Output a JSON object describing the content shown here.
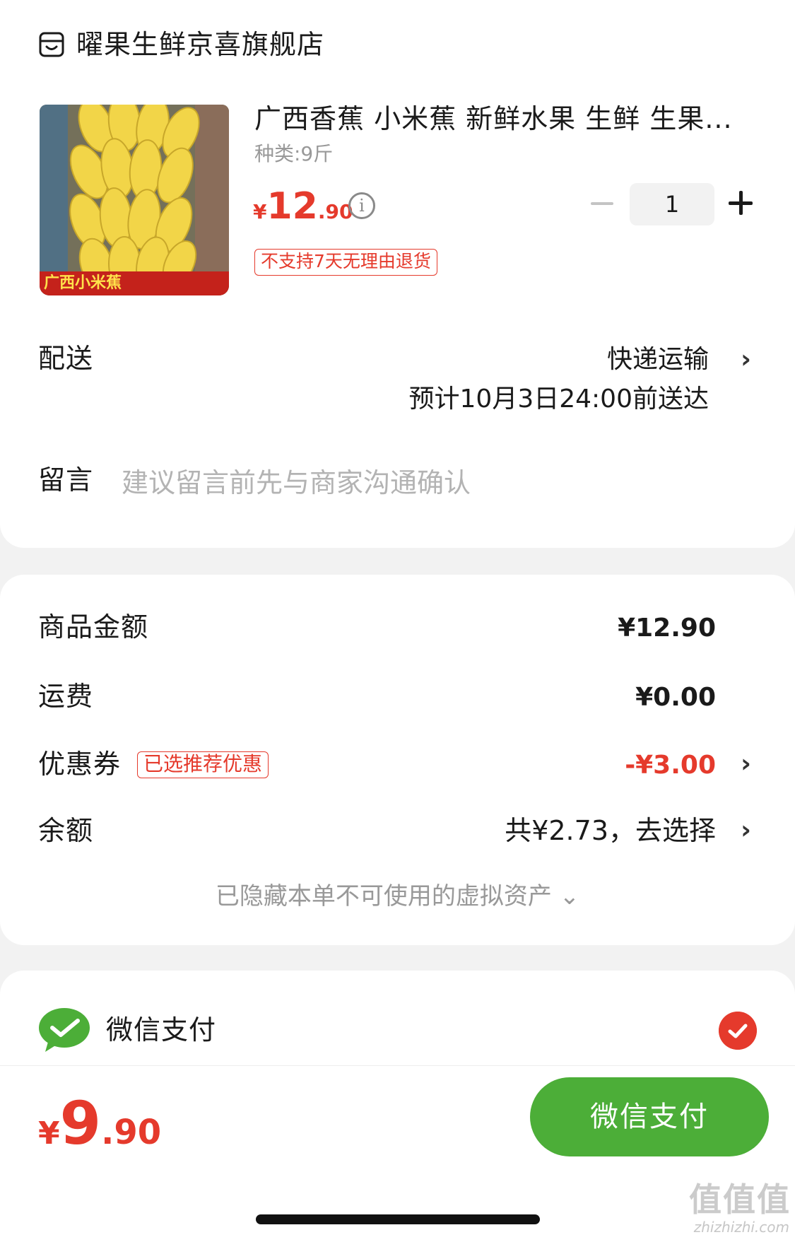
{
  "shop": {
    "name": "曜果生鲜京喜旗舰店",
    "icon": "store-icon"
  },
  "product": {
    "image_tag": "广西小米蕉",
    "title": "广西香蕉 小米蕉  新鲜水果 生鲜 生果...",
    "spec": "种类:9斤",
    "price_yen": "¥",
    "price_int": "12",
    "price_dec": ".90",
    "quantity": "1",
    "return_policy": "不支持7天无理由退货"
  },
  "delivery": {
    "label": "配送",
    "method": "快递运输",
    "eta": "预计10月3日24:00前送达"
  },
  "message": {
    "label": "留言",
    "placeholder": "建议留言前先与商家沟通确认"
  },
  "summary": {
    "goods_label": "商品金额",
    "goods_amount": "¥12.90",
    "shipping_label": "运费",
    "shipping_amount": "¥0.00",
    "coupon_label": "优惠券",
    "coupon_badge": "已选推荐优惠",
    "coupon_amount": "-¥3.00",
    "balance_label": "余额",
    "balance_value": "共¥2.73，去选择",
    "hidden_note": "已隐藏本单不可使用的虚拟资产 ⌄"
  },
  "payment": {
    "method_label": "微信支付",
    "selected": true
  },
  "footer": {
    "total_yen": "¥",
    "total_int": "9",
    "total_dec": ".90",
    "pay_button": "微信支付",
    "watermark": "值值值",
    "watermark_sub": "zhizhizhi.com"
  },
  "colors": {
    "accent_red": "#e53a2c",
    "wechat_green": "#4cae38"
  }
}
